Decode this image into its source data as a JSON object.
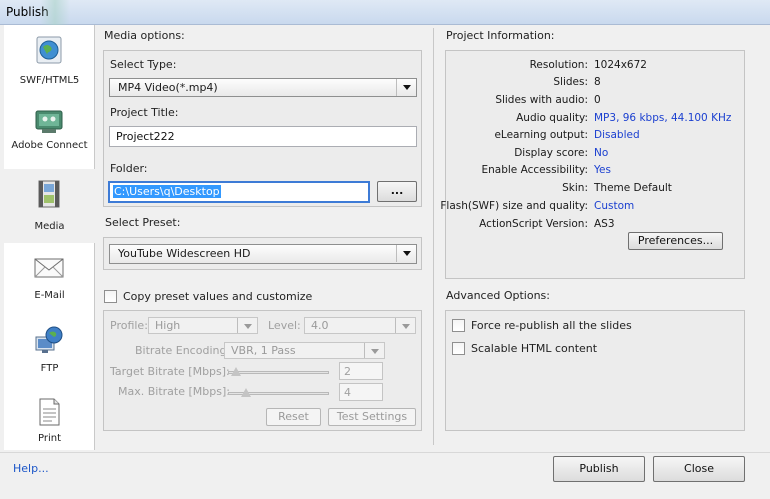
{
  "window": {
    "title": "Publish"
  },
  "sidebar": {
    "items": [
      {
        "label": "SWF/HTML5",
        "icon": "globe-icon"
      },
      {
        "label": "Adobe Connect",
        "icon": "adobe-connect-icon"
      },
      {
        "label": "Media",
        "icon": "film-strip-icon"
      },
      {
        "label": "E-Mail",
        "icon": "envelope-icon"
      },
      {
        "label": "FTP",
        "icon": "globe-monitor-icon"
      },
      {
        "label": "Print",
        "icon": "document-icon"
      }
    ]
  },
  "media": {
    "section_label": "Media options:",
    "select_type_label": "Select Type:",
    "select_type_value": "MP4 Video(*.mp4)",
    "project_title_label": "Project Title:",
    "project_title_value": "Project222",
    "folder_label": "Folder:",
    "folder_value": "C:\\Users\\q\\Desktop",
    "browse_label": "...",
    "preset_label": "Select Preset:",
    "preset_value": "YouTube Widescreen HD",
    "copy_preset_label": "Copy preset values and customize",
    "profile_label": "Profile:",
    "profile_value": "High",
    "level_label": "Level:",
    "level_value": "4.0",
    "bitrate_encoding_label": "Bitrate Encoding:",
    "bitrate_encoding_value": "VBR, 1 Pass",
    "target_bitrate_label": "Target Bitrate [Mbps]:",
    "target_bitrate_value": "2",
    "max_bitrate_label": "Max. Bitrate [Mbps]:",
    "max_bitrate_value": "4",
    "reset_label": "Reset",
    "test_settings_label": "Test Settings"
  },
  "project_info": {
    "section_label": "Project Information:",
    "rows": [
      {
        "key": "Resolution:",
        "value": "1024x672",
        "link": false
      },
      {
        "key": "Slides:",
        "value": "8",
        "link": false
      },
      {
        "key": "Slides with audio:",
        "value": "0",
        "link": false
      },
      {
        "key": "Audio quality:",
        "value": "MP3, 96 kbps, 44.100 KHz",
        "link": true
      },
      {
        "key": "eLearning output:",
        "value": "Disabled",
        "link": true
      },
      {
        "key": "Display score:",
        "value": "No",
        "link": true
      },
      {
        "key": "Enable Accessibility:",
        "value": "Yes",
        "link": true
      },
      {
        "key": "Skin:",
        "value": "Theme Default",
        "link": false
      },
      {
        "key": "Flash(SWF) size and quality:",
        "value": "Custom",
        "link": true
      },
      {
        "key": "ActionScript Version:",
        "value": "AS3",
        "link": false
      }
    ],
    "preferences_label": "Preferences..."
  },
  "advanced": {
    "section_label": "Advanced Options:",
    "force_republish_label": "Force re-publish all the slides",
    "scalable_html_label": "Scalable HTML content"
  },
  "footer": {
    "help_label": "Help...",
    "publish_label": "Publish",
    "close_label": "Close"
  },
  "colors": {
    "link": "#1a3fd0",
    "focus": "#3d7bd6",
    "selection": "#3399ff"
  }
}
